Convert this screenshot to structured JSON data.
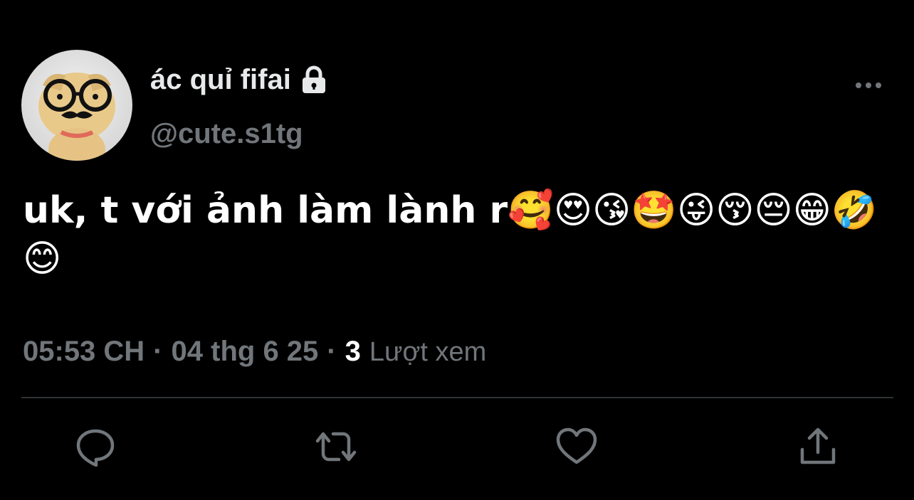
{
  "author": {
    "display_name": "ác quỉ fifai",
    "handle": "@cute.s1tg",
    "protected_icon": "lock-icon",
    "avatar": "avatar"
  },
  "tweet": {
    "text": "uk, t với ảnh làm lành r🥰😍😘🤩😜😚😔😁🤣😊"
  },
  "meta": {
    "time": "05:53 CH",
    "separator": "·",
    "date": "04 thg 6 25",
    "views_count": "3",
    "views_label": "Lượt xem"
  },
  "actions": {
    "reply_icon": "reply-icon",
    "retweet_icon": "retweet-icon",
    "like_icon": "heart-icon",
    "share_icon": "share-icon",
    "more_icon": "more-icon"
  },
  "colors": {
    "background": "#000000",
    "primary_text": "#e7e9ea",
    "secondary_text": "#71767b",
    "divider": "#2f3336"
  }
}
